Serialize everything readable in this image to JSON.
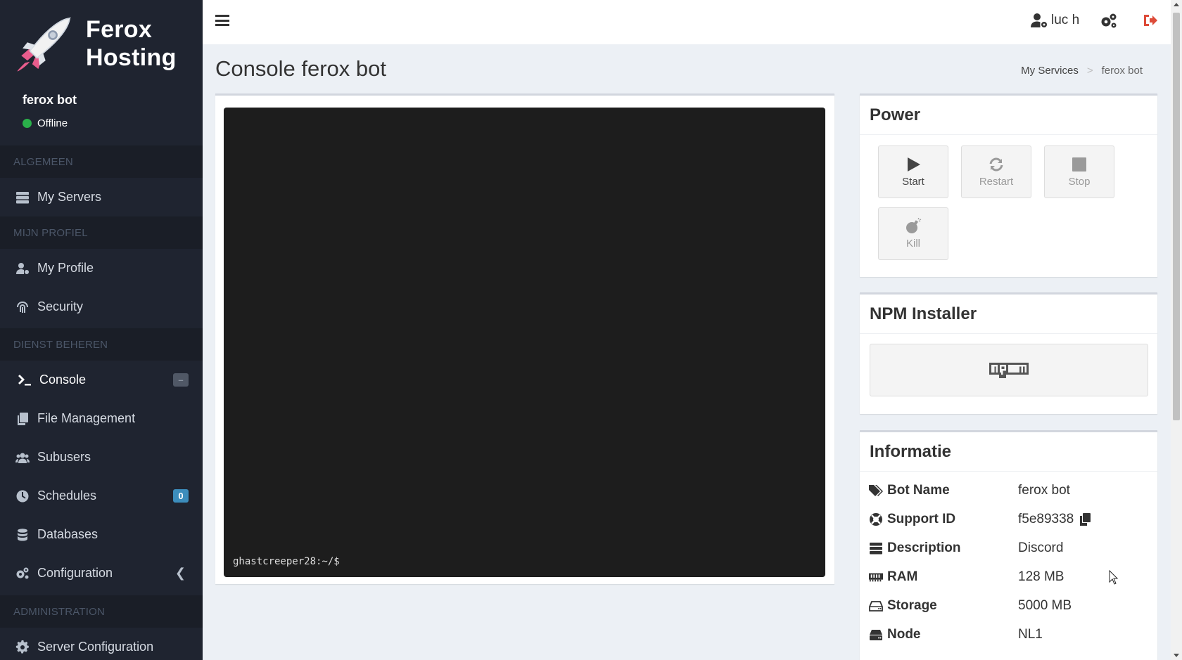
{
  "brand": {
    "line1": "Ferox",
    "line2": "Hosting"
  },
  "server": {
    "name": "ferox bot",
    "status": "Offline"
  },
  "sidebar": {
    "sections": [
      {
        "title": "ALGEMEEN"
      },
      {
        "title": "MIJN PROFIEL"
      },
      {
        "title": "DIENST BEHEREN"
      },
      {
        "title": "ADMINISTRATION"
      }
    ],
    "items": [
      {
        "label": "My Servers"
      },
      {
        "label": "My Profile"
      },
      {
        "label": "Security"
      },
      {
        "label": "Console",
        "badge": "–"
      },
      {
        "label": "File Management"
      },
      {
        "label": "Subusers"
      },
      {
        "label": "Schedules",
        "badge": "0"
      },
      {
        "label": "Databases"
      },
      {
        "label": "Configuration"
      },
      {
        "label": "Server Configuration"
      }
    ]
  },
  "topbar": {
    "user": "luc h"
  },
  "page": {
    "title": "Console ferox bot",
    "breadcrumb": [
      "My Services",
      "ferox bot"
    ]
  },
  "console": {
    "prompt": "ghastcreeper28:~/$"
  },
  "power": {
    "title": "Power",
    "buttons": [
      {
        "label": "Start",
        "icon": "play-icon"
      },
      {
        "label": "Restart",
        "icon": "refresh-icon"
      },
      {
        "label": "Stop",
        "icon": "stop-icon"
      },
      {
        "label": "Kill",
        "icon": "bomb-icon"
      }
    ]
  },
  "npm": {
    "title": "NPM Installer",
    "button": "npm"
  },
  "info": {
    "title": "Informatie",
    "rows": [
      {
        "key": "Bot Name",
        "value": "ferox bot"
      },
      {
        "key": "Support ID",
        "value": "f5e89338"
      },
      {
        "key": "Description",
        "value": "Discord"
      },
      {
        "key": "RAM",
        "value": "128 MB"
      },
      {
        "key": "Storage",
        "value": "5000 MB"
      },
      {
        "key": "Node",
        "value": "NL1"
      }
    ]
  },
  "colors": {
    "sidebar": "#1f2430",
    "accent": "#3c8dbc",
    "online_dot": "#2ab04a",
    "logout": "#dd4b39"
  }
}
